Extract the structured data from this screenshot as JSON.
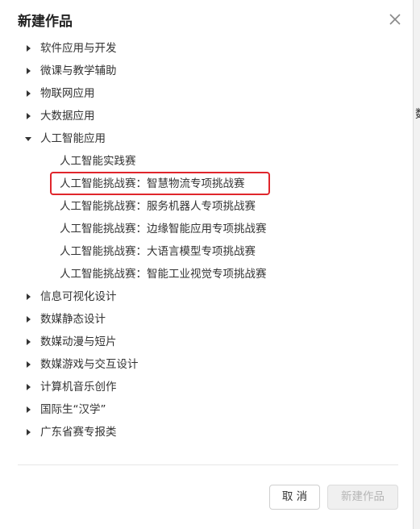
{
  "dialog": {
    "title": "新建作品",
    "close_icon": "close-icon"
  },
  "tree": [
    {
      "label": "软件应用与开发",
      "expanded": false
    },
    {
      "label": "微课与教学辅助",
      "expanded": false
    },
    {
      "label": "物联网应用",
      "expanded": false
    },
    {
      "label": "大数据应用",
      "expanded": false
    },
    {
      "label": "人工智能应用",
      "expanded": true,
      "children": [
        {
          "label": "人工智能实践赛"
        },
        {
          "label": "人工智能挑战赛：智慧物流专项挑战赛",
          "highlighted": true
        },
        {
          "label": "人工智能挑战赛：服务机器人专项挑战赛"
        },
        {
          "label": "人工智能挑战赛：边缘智能应用专项挑战赛"
        },
        {
          "label": "人工智能挑战赛：大语言模型专项挑战赛"
        },
        {
          "label": "人工智能挑战赛：智能工业视觉专项挑战赛"
        }
      ]
    },
    {
      "label": "信息可视化设计",
      "expanded": false
    },
    {
      "label": "数媒静态设计",
      "expanded": false
    },
    {
      "label": "数媒动漫与短片",
      "expanded": false
    },
    {
      "label": "数媒游戏与交互设计",
      "expanded": false
    },
    {
      "label": "计算机音乐创作",
      "expanded": false
    },
    {
      "label": "国际生“汉学”",
      "expanded": false
    },
    {
      "label": "广东省赛专报类",
      "expanded": false
    }
  ],
  "footer": {
    "cancel_label": "取 消",
    "create_label": "新建作品"
  },
  "colors": {
    "highlight_border": "#e0262c",
    "arrow": "#333333"
  }
}
